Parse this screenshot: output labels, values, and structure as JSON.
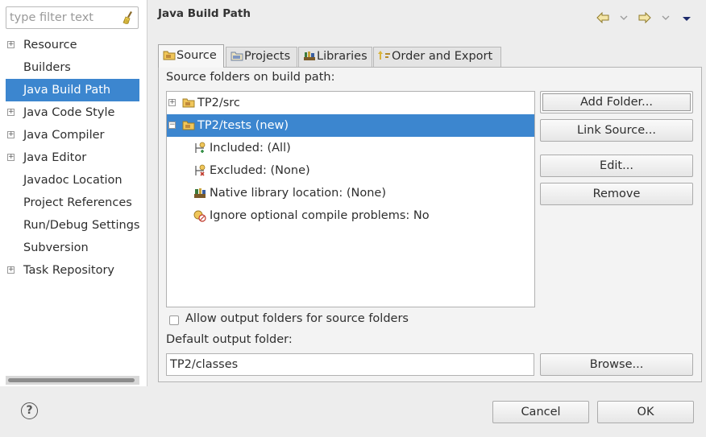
{
  "filter": {
    "placeholder": "type filter text",
    "icon": "broom-icon"
  },
  "sidebar": {
    "items": [
      {
        "label": "Resource",
        "expandable": true,
        "selected": false
      },
      {
        "label": "Builders",
        "expandable": false,
        "selected": false
      },
      {
        "label": "Java Build Path",
        "expandable": false,
        "selected": true
      },
      {
        "label": "Java Code Style",
        "expandable": true,
        "selected": false
      },
      {
        "label": "Java Compiler",
        "expandable": true,
        "selected": false
      },
      {
        "label": "Java Editor",
        "expandable": true,
        "selected": false
      },
      {
        "label": "Javadoc Location",
        "expandable": false,
        "selected": false
      },
      {
        "label": "Project References",
        "expandable": false,
        "selected": false
      },
      {
        "label": "Run/Debug Settings",
        "expandable": false,
        "selected": false
      },
      {
        "label": "Subversion",
        "expandable": false,
        "selected": false
      },
      {
        "label": "Task Repository",
        "expandable": true,
        "selected": false
      }
    ]
  },
  "header": {
    "title": "Java Build Path",
    "nav_icons": [
      "back-arrow-icon",
      "back-dropdown-icon",
      "forward-arrow-icon",
      "forward-dropdown-icon",
      "view-menu-icon"
    ]
  },
  "tabs": [
    {
      "label": "Source",
      "icon": "source-folder-icon",
      "active": true
    },
    {
      "label": "Projects",
      "icon": "projects-icon",
      "active": false
    },
    {
      "label": "Libraries",
      "icon": "libraries-icon",
      "active": false
    },
    {
      "label": "Order and Export",
      "icon": "order-export-icon",
      "active": false
    }
  ],
  "source": {
    "folders_label": "Source folders on build path:",
    "tree": [
      {
        "label": "TP2/src",
        "level": 0,
        "expander": "+",
        "icon": "package-folder-icon",
        "selected": false
      },
      {
        "label": "TP2/tests (new)",
        "level": 0,
        "expander": "−",
        "icon": "package-folder-icon",
        "selected": true
      },
      {
        "label": "Included: (All)",
        "level": 1,
        "icon": "inclusion-filter-icon",
        "selected": false
      },
      {
        "label": "Excluded: (None)",
        "level": 1,
        "icon": "exclusion-filter-icon",
        "selected": false
      },
      {
        "label": "Native library location: (None)",
        "level": 1,
        "icon": "native-library-icon",
        "selected": false
      },
      {
        "label": "Ignore optional compile problems: No",
        "level": 1,
        "icon": "ignore-problems-icon",
        "selected": false
      }
    ],
    "buttons": {
      "add_folder": "Add Folder...",
      "link_source": "Link Source...",
      "edit": "Edit...",
      "remove": "Remove"
    },
    "allow_output_label": "Allow output folders for source folders",
    "allow_output_checked": false,
    "default_output_label": "Default output folder:",
    "default_output_value": "TP2/classes",
    "browse": "Browse..."
  },
  "footer": {
    "cancel": "Cancel",
    "ok": "OK",
    "help_glyph": "?"
  },
  "colors": {
    "selection": "#3c86cf",
    "background": "#ededed"
  }
}
